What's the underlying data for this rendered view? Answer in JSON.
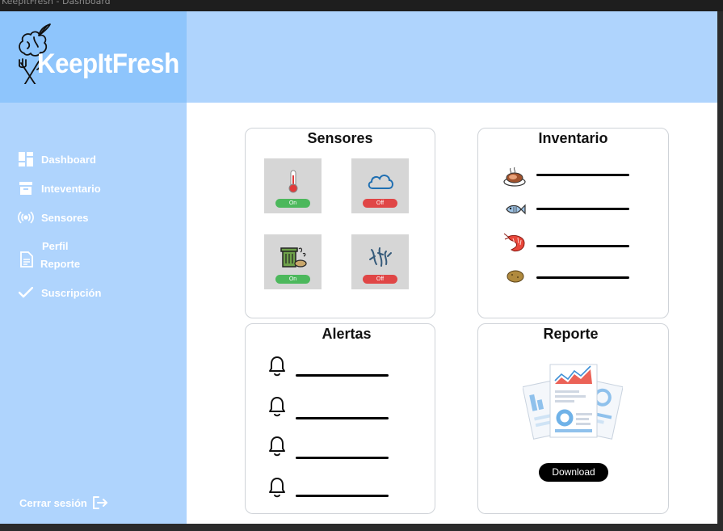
{
  "window": {
    "title": "KeepItFresh - Dashboard"
  },
  "brand": {
    "name": "KeepItFresh"
  },
  "nav": {
    "dashboard": "Dashboard",
    "inventario": "Inteventario",
    "sensores": "Sensores",
    "perfil": "Perfil",
    "reporte": "Reporte",
    "suscripcion": "Suscripción",
    "logout": "Cerrar sesión"
  },
  "cards": {
    "sensores": {
      "title": "Sensores",
      "tiles": [
        {
          "icon": "thermometer-icon",
          "state": "On"
        },
        {
          "icon": "cloud-icon",
          "state": "Off"
        },
        {
          "icon": "waste-icon",
          "state": "On"
        },
        {
          "icon": "bacteria-icon",
          "state": "Off"
        }
      ]
    },
    "inventario": {
      "title": "Inventario",
      "items": [
        "meat-icon",
        "fish-icon",
        "shrimp-icon",
        "potato-icon"
      ]
    },
    "alertas": {
      "title": "Alertas",
      "count": 4
    },
    "reporte": {
      "title": "Reporte",
      "download_label": "Download"
    }
  },
  "colors": {
    "sidebar": "#afd4fd",
    "logo_bg": "#8ec5fc",
    "on": "#4cb85c",
    "off": "#e04646"
  }
}
